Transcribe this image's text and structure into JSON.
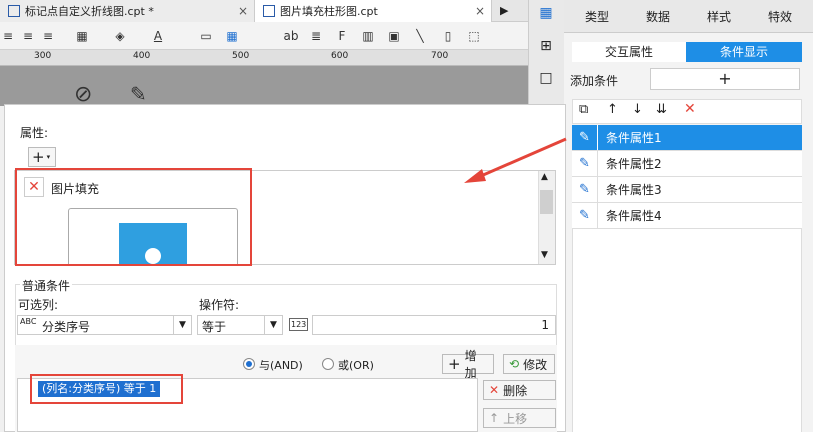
{
  "tabs": [
    {
      "label": "标记点自定义折线图.cpt *",
      "close": "×"
    },
    {
      "label": "图片填充柱形图.cpt",
      "close": "×"
    }
  ],
  "ruler": {
    "ticks": [
      "300",
      "400",
      "500",
      "600",
      "700"
    ]
  },
  "right_panel": {
    "tabs": [
      "类型",
      "数据",
      "样式",
      "特效"
    ],
    "active_tab": "特效",
    "subtabs": [
      "交互属性",
      "条件显示"
    ],
    "add_condition_label": "添加条件",
    "add_plus": "+",
    "conditions": [
      "条件属性1",
      "条件属性2",
      "条件属性3",
      "条件属性4"
    ]
  },
  "dialog": {
    "properties_label": "属性:",
    "property_item": "图片填充",
    "general_condition_label": "普通条件",
    "column_label": "可选列:",
    "column_value": "分类序号",
    "operator_label": "操作符:",
    "operator_value": "等于",
    "value_input": "1",
    "and_label": "与(AND)",
    "or_label": "或(OR)",
    "add_button": "增加",
    "modify_button": "修改",
    "condition_expr": "(列名:分类序号) 等于 1",
    "delete_button": "删除",
    "up_button": "上移"
  },
  "colors": {
    "accent": "#1e8ee6",
    "highlight": "#e4453a",
    "image_fill": "#2f9fe0"
  }
}
